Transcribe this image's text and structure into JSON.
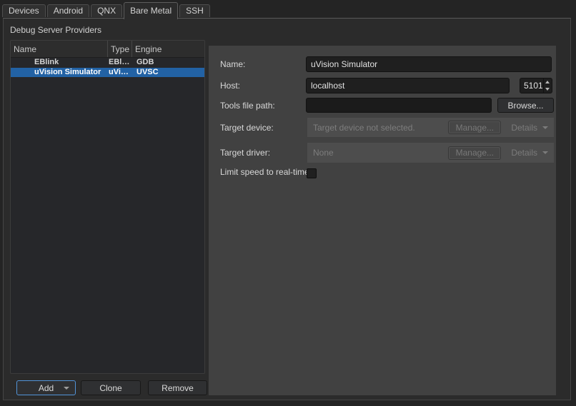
{
  "tabs": {
    "items": [
      {
        "label": "Devices"
      },
      {
        "label": "Android"
      },
      {
        "label": "QNX"
      },
      {
        "label": "Bare Metal"
      },
      {
        "label": "SSH"
      }
    ],
    "active": "Bare Metal"
  },
  "section_title": "Debug Server Providers",
  "table": {
    "columns": [
      "Name",
      "Type",
      "Engine"
    ],
    "rows": [
      {
        "name": "EBlink",
        "type": "EBl…",
        "engine": "GDB"
      },
      {
        "name": "uVision Simulator",
        "type": "uVi…",
        "engine": "UVSC"
      }
    ],
    "selected_row": "uVision Simulator"
  },
  "actions": {
    "add": "Add",
    "clone": "Clone",
    "remove": "Remove"
  },
  "form": {
    "name": {
      "label": "Name:",
      "value": "uVision Simulator"
    },
    "host": {
      "label": "Host:",
      "value": "localhost",
      "port": "5101"
    },
    "tools_file_path": {
      "label": "Tools file path:",
      "value": "",
      "browse": "Browse..."
    },
    "target_device": {
      "label": "Target device:",
      "text": "Target device not selected.",
      "manage": "Manage...",
      "details": "Details"
    },
    "target_driver": {
      "label": "Target driver:",
      "text": "None",
      "manage": "Manage...",
      "details": "Details"
    },
    "limit_speed": {
      "label": "Limit speed to real-time:",
      "checked": false
    }
  },
  "colors": {
    "highlight": "#2262a5",
    "focus": "#5294d8",
    "panel_bg": "#414141",
    "pane_bg": "#2b2b2b",
    "window_bg": "#242424"
  }
}
